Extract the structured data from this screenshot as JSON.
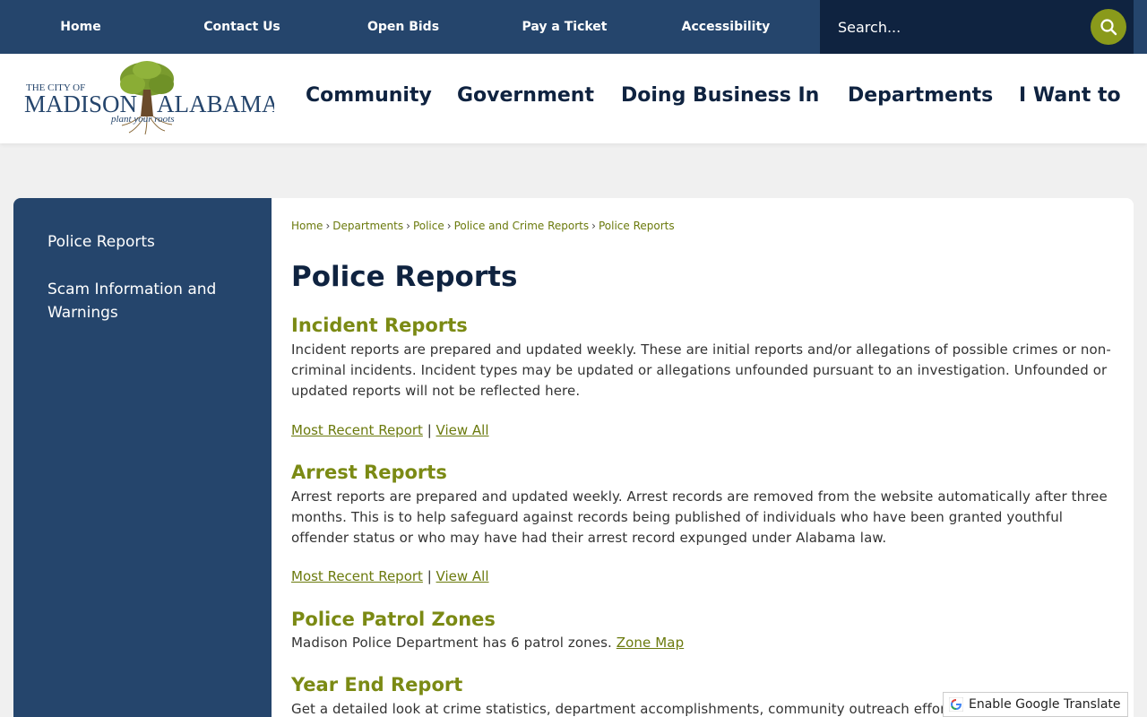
{
  "topnav": {
    "items": [
      "Home",
      "Contact Us",
      "Open Bids",
      "Pay a Ticket",
      "Accessibility"
    ]
  },
  "search": {
    "placeholder": "Search..."
  },
  "logo": {
    "line1": "THE CITY OF",
    "madison": "MADISON",
    "alabama": "ALABAMA",
    "tagline": "plant your roots"
  },
  "mainnav": {
    "items": [
      "Community",
      "Government",
      "Doing Business In",
      "Departments",
      "I Want to"
    ]
  },
  "sidebar": {
    "items": [
      "Police Reports",
      "Scam Information and Warnings"
    ]
  },
  "breadcrumb": {
    "items": [
      "Home",
      "Departments",
      "Police",
      "Police and Crime Reports",
      "Police Reports"
    ]
  },
  "page": {
    "title": "Police Reports",
    "sections": [
      {
        "title": "Incident Reports",
        "text": "Incident reports are prepared and updated weekly.  These are initial reports and/or allegations of possible crimes or non-criminal incidents. Incident types may be updated or allegations unfounded pursuant to an investigation. Unfounded or updated reports will not be reflected here.",
        "link1": "Most Recent Report",
        "separator": "|",
        "link2": "View All"
      },
      {
        "title": "Arrest Reports",
        "text": "Arrest reports are prepared and updated weekly.  Arrest records are removed from the website automatically after three months. This is to help safeguard against records being published of individuals who have been granted youthful offender status or who may have had their arrest record expunged under Alabama law.",
        "link1": "Most Recent Report",
        "separator": "|",
        "link2": "View All"
      },
      {
        "title": "Police Patrol Zones",
        "text": "Madison Police Department has 6 patrol zones. ",
        "link": "Zone Map"
      },
      {
        "title": "Year End Report",
        "text": "Get a detailed look at crime statistics, department accomplishments, community outreach effor"
      }
    ]
  },
  "translate": {
    "label": "Enable Google Translate"
  },
  "colors": {
    "navy": "#25456c",
    "dark_navy": "#0f2340",
    "olive": "#7b8a14",
    "olive_link": "#6b7a0d"
  }
}
